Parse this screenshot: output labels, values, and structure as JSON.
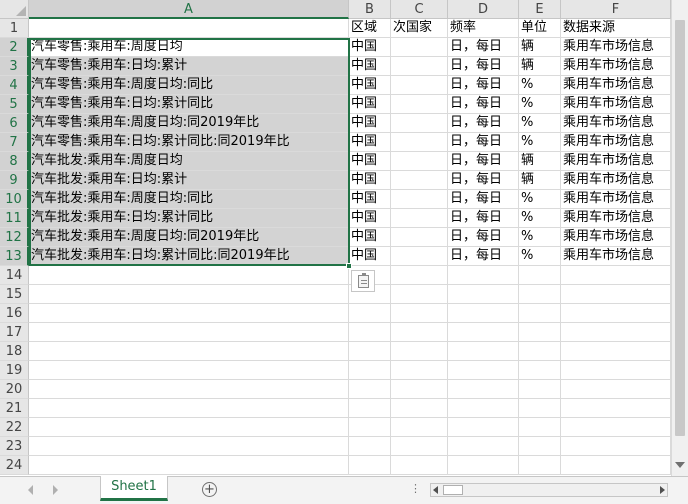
{
  "columns": [
    "A",
    "B",
    "C",
    "D",
    "E",
    "F"
  ],
  "row_numbers": [
    "1",
    "2",
    "3",
    "4",
    "5",
    "6",
    "7",
    "8",
    "9",
    "10",
    "11",
    "12",
    "13",
    "14",
    "15",
    "16",
    "17",
    "18",
    "19",
    "20",
    "21",
    "22",
    "23",
    "24"
  ],
  "header_row": [
    "",
    "区域",
    "次国家",
    "频率",
    "单位",
    "数据来源"
  ],
  "rows": [
    [
      "汽车零售:乘用车:周度日均",
      "中国",
      "",
      "日，每日",
      "辆",
      "乘用车市场信息"
    ],
    [
      "汽车零售:乘用车:日均:累计",
      "中国",
      "",
      "日，每日",
      "辆",
      "乘用车市场信息"
    ],
    [
      "汽车零售:乘用车:周度日均:同比",
      "中国",
      "",
      "日，每日",
      "%",
      "乘用车市场信息"
    ],
    [
      "汽车零售:乘用车:日均:累计同比",
      "中国",
      "",
      "日，每日",
      "%",
      "乘用车市场信息"
    ],
    [
      "汽车零售:乘用车:周度日均:同2019年比",
      "中国",
      "",
      "日，每日",
      "%",
      "乘用车市场信息"
    ],
    [
      "汽车零售:乘用车:日均:累计同比:同2019年比",
      "中国",
      "",
      "日，每日",
      "%",
      "乘用车市场信息"
    ],
    [
      "汽车批发:乘用车:周度日均",
      "中国",
      "",
      "日，每日",
      "辆",
      "乘用车市场信息"
    ],
    [
      "汽车批发:乘用车:日均:累计",
      "中国",
      "",
      "日，每日",
      "辆",
      "乘用车市场信息"
    ],
    [
      "汽车批发:乘用车:周度日均:同比",
      "中国",
      "",
      "日，每日",
      "%",
      "乘用车市场信息"
    ],
    [
      "汽车批发:乘用车:日均:累计同比",
      "中国",
      "",
      "日，每日",
      "%",
      "乘用车市场信息"
    ],
    [
      "汽车批发:乘用车:周度日均:同2019年比",
      "中国",
      "",
      "日，每日",
      "%",
      "乘用车市场信息"
    ],
    [
      "汽车批发:乘用车:日均:累计同比:同2019年比",
      "中国",
      "",
      "日，每日",
      "%",
      "乘用车市场信息"
    ]
  ],
  "selection": {
    "range": "A2:A13",
    "active_cell": "A2"
  },
  "sheet_tabs": [
    {
      "label": "Sheet1",
      "active": true
    }
  ],
  "add_sheet_label": "+",
  "tab_overflow_dots": "⋮",
  "colors": {
    "accent": "#217346",
    "selection_fill": "#d3d3d3",
    "header_bg": "#e6e6e6",
    "gridline": "#dadada"
  }
}
